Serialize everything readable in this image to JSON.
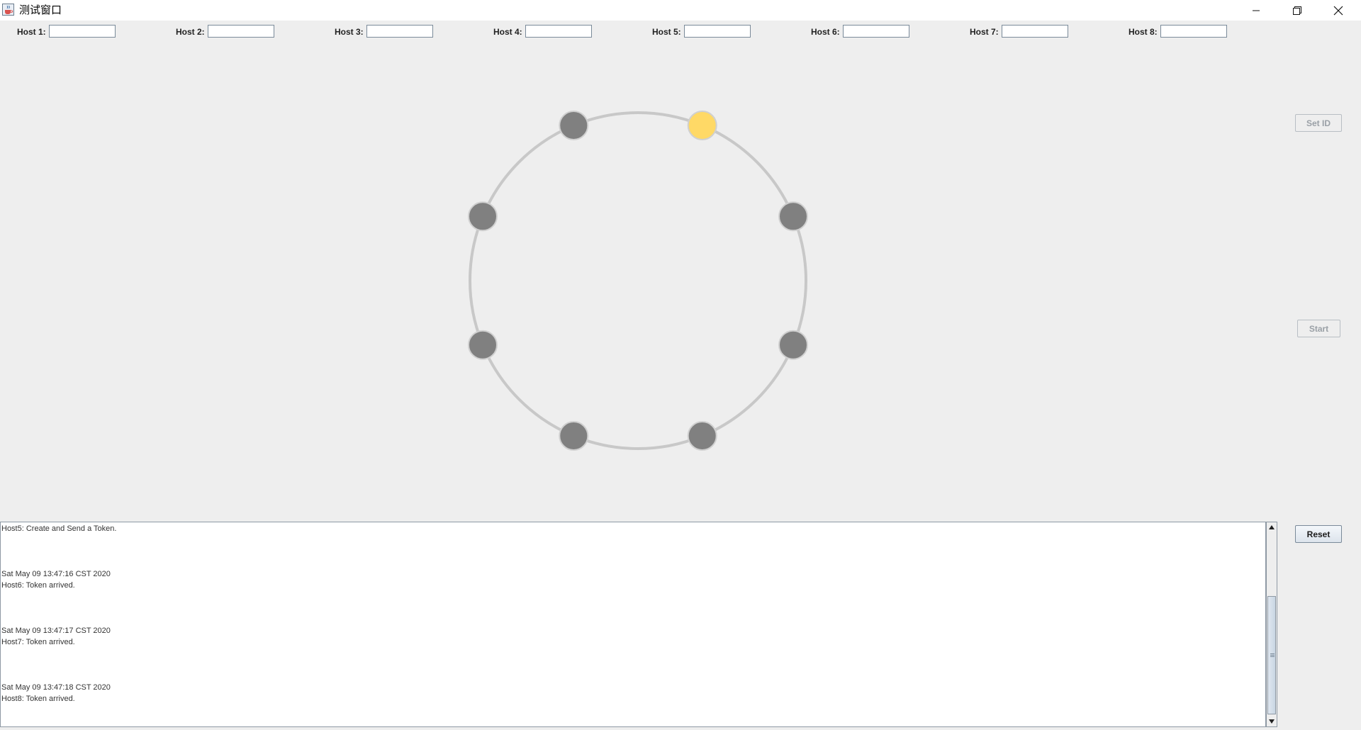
{
  "window": {
    "title": "测试窗口",
    "app_icon": "java-coffee-icon",
    "minimize_icon": "minimize-icon",
    "restore_icon": "restore-icon",
    "close_icon": "close-icon"
  },
  "hosts": [
    {
      "label": "Host 1:",
      "value": ""
    },
    {
      "label": "Host 2:",
      "value": ""
    },
    {
      "label": "Host 3:",
      "value": ""
    },
    {
      "label": "Host 4:",
      "value": ""
    },
    {
      "label": "Host 5:",
      "value": ""
    },
    {
      "label": "Host 6:",
      "value": ""
    },
    {
      "label": "Host 7:",
      "value": ""
    },
    {
      "label": "Host 8:",
      "value": ""
    }
  ],
  "ring": {
    "ring_color": "#c8c8c8",
    "node_color": "#808080",
    "active_node_color": "#ffd966",
    "active_node": 5
  },
  "buttons": {
    "set_id": "Set ID",
    "start": "Start",
    "reset": "Reset"
  },
  "log": {
    "lines": [
      "Host5: Create and Send a Token.",
      "",
      "",
      "",
      "Sat May 09 13:47:16 CST 2020",
      "Host6: Token arrived.",
      "",
      "",
      "",
      "Sat May 09 13:47:17 CST 2020",
      "Host7: Token arrived.",
      "",
      "",
      "",
      "Sat May 09 13:47:18 CST 2020",
      "Host8: Token arrived."
    ]
  }
}
